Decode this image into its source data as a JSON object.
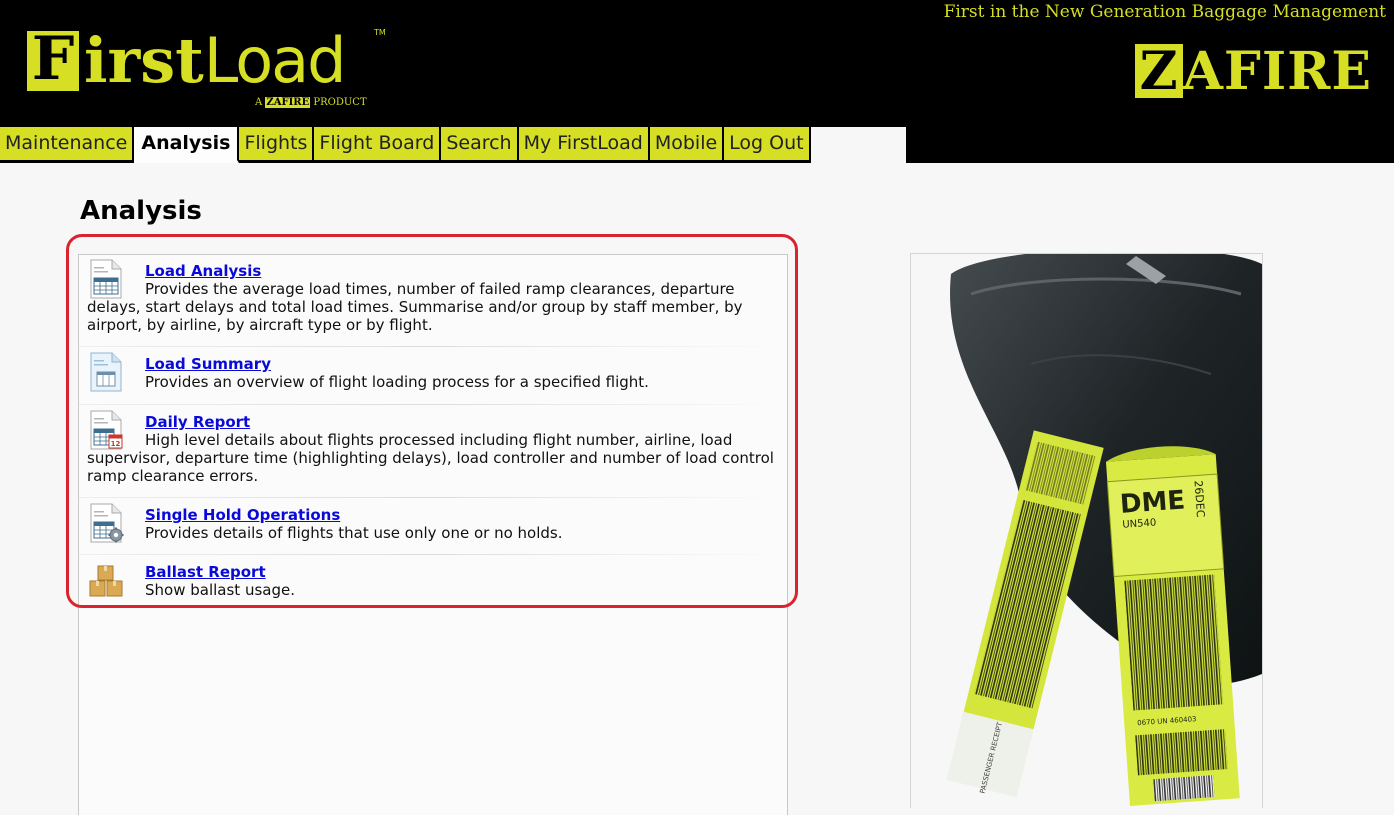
{
  "header": {
    "logo_letter": "F",
    "logo_rest_bold": "irst",
    "logo_rest_light": "Load",
    "logo_tm": "TM",
    "logo_sub_prefix": "A",
    "logo_sub_brand": "ZAFIRE",
    "logo_sub_suffix": "PRODUCT",
    "tagline": "First in the New Generation Baggage Management",
    "brand_letter": "Z",
    "brand_rest": "AFIRE"
  },
  "nav": {
    "tabs": [
      {
        "label": "Maintenance"
      },
      {
        "label": "Analysis"
      },
      {
        "label": "Flights"
      },
      {
        "label": "Flight Board"
      },
      {
        "label": "Search"
      },
      {
        "label": "My FirstLoad"
      },
      {
        "label": "Mobile"
      },
      {
        "label": "Log Out"
      }
    ],
    "active": "Analysis"
  },
  "main": {
    "title": "Analysis",
    "items": [
      {
        "title": "Load Analysis",
        "description": "Provides the average load times, number of failed ramp clearances, departure delays, start delays and total load times. Summarise and/or group by staff member, by airport, by airline, by aircraft type or by flight.",
        "icon": "spreadsheet-icon"
      },
      {
        "title": "Load Summary",
        "description": "Provides an overview of flight loading process for a specified flight.",
        "icon": "summary-document-icon"
      },
      {
        "title": "Daily Report",
        "description": "High level details about flights processed including flight number, airline, load supervisor, departure time (highlighting delays), load controller and number of load control ramp clearance errors.",
        "icon": "calendar-report-icon"
      },
      {
        "title": "Single Hold Operations",
        "description": "Provides details of flights that use only one or no holds.",
        "icon": "report-gear-icon"
      },
      {
        "title": "Ballast Report",
        "description": "Show ballast usage.",
        "icon": "boxes-icon"
      }
    ]
  },
  "photo": {
    "tag_left_text": "PASSENGER RECEIPT",
    "tag_right_code": "DME",
    "tag_right_flight": "UN540",
    "tag_right_side": "26DEC",
    "tag_right_number": "0670 UN 460403"
  },
  "colors": {
    "brand": "#d6df23",
    "header_bg": "#000000",
    "link": "#0a0ad8",
    "highlight": "#d9232d"
  }
}
